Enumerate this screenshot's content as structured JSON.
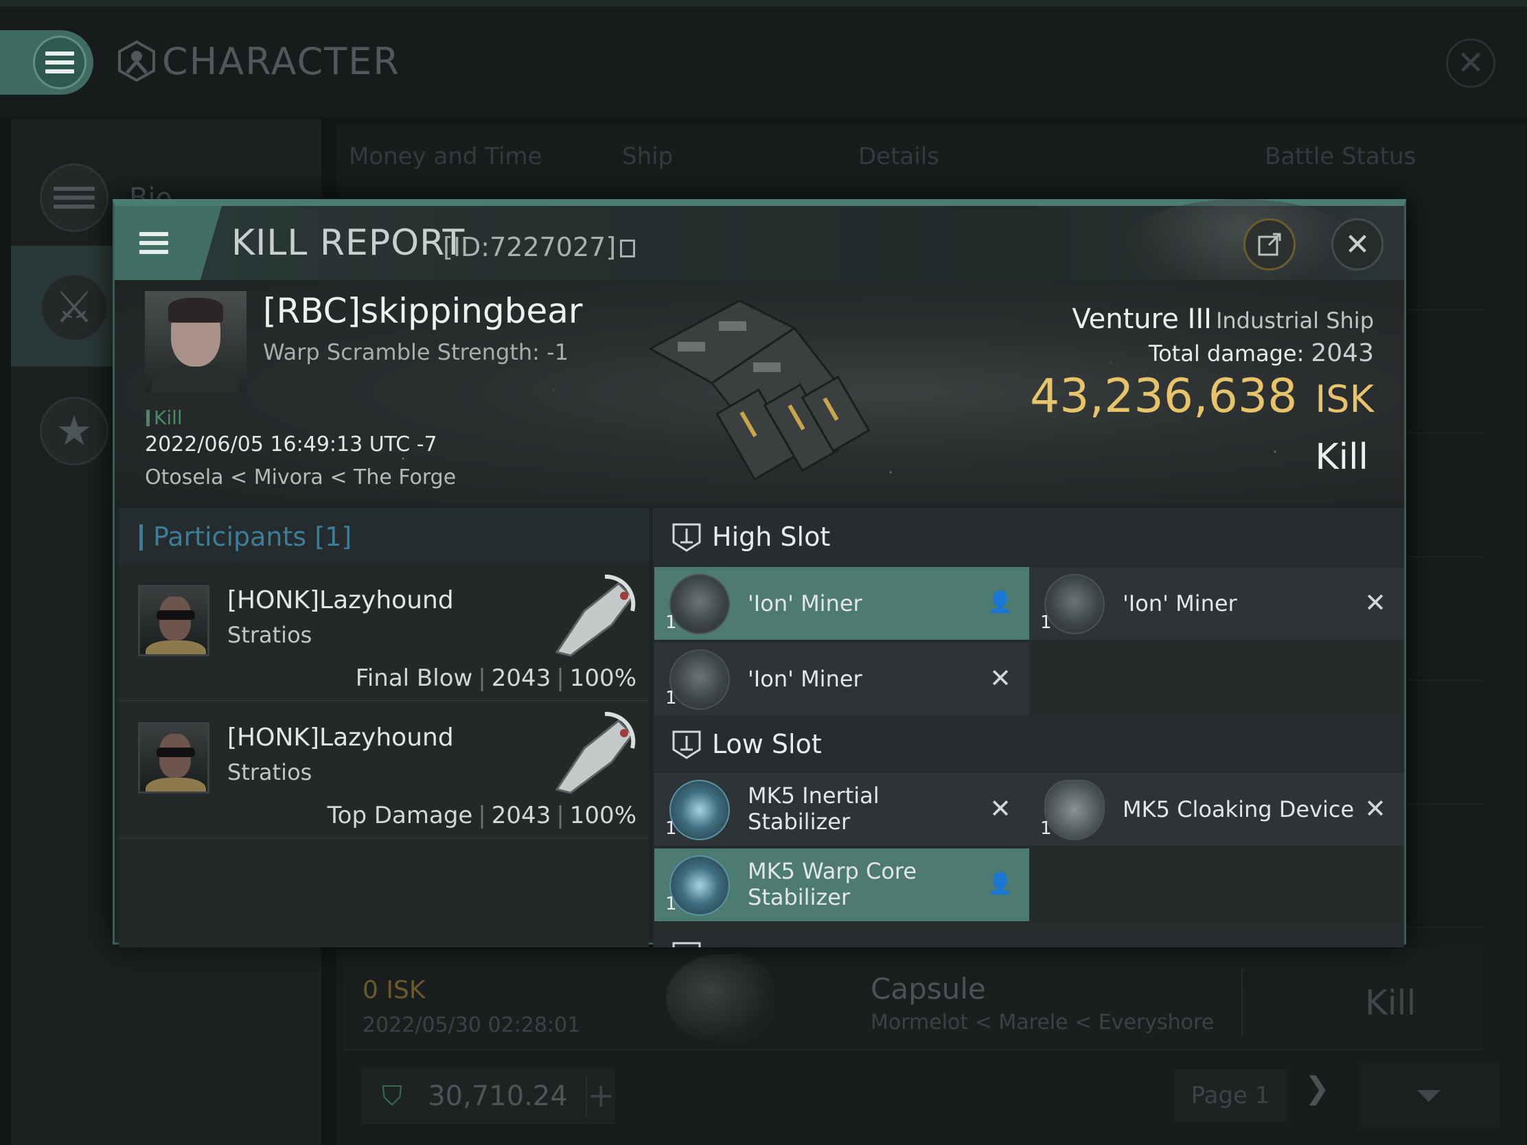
{
  "window": {
    "title": "CHARACTER",
    "icons": {
      "menu": "hamburger-icon",
      "character": "character-emblem-icon",
      "close": "close-icon"
    }
  },
  "sidebar": {
    "items": [
      {
        "label": "Bio",
        "icon": "hamburger-icon"
      },
      {
        "label": "",
        "icon": "crossed-swords-icon"
      },
      {
        "label": "",
        "icon": "star-badge-icon"
      }
    ]
  },
  "tabs": [
    "Money and Time",
    "Ship",
    "Details",
    "Battle Status"
  ],
  "kill_report": {
    "title": "KILL REPORT",
    "id_label": "[ID:7227027]",
    "victim": {
      "name": "[RBC]skippingbear",
      "warp_scramble": "Warp Scramble Strength: -1",
      "type_tag": "Kill",
      "date": "2022/06/05 16:49:13 UTC -7",
      "location": "Otosela < Mivora < The Forge",
      "ship_name": "Venture III",
      "ship_class": "Industrial Ship",
      "total_damage_label": "Total damage:",
      "total_damage_value": "2043",
      "isk_value": "43,236,638",
      "isk_unit": "ISK",
      "result": "Kill"
    },
    "participants": {
      "title": "Participants",
      "count": "[1]",
      "rows": [
        {
          "name": "[HONK]Lazyhound",
          "ship": "Stratios",
          "role": "Final Blow",
          "damage": "2043",
          "percent": "100%"
        },
        {
          "name": "[HONK]Lazyhound",
          "ship": "Stratios",
          "role": "Top Damage",
          "damage": "2043",
          "percent": "100%"
        }
      ]
    },
    "high_slot": {
      "title": "High Slot",
      "modules": [
        {
          "name": "'Ion' Miner",
          "qty": "1",
          "state": "dropped"
        },
        {
          "name": "'Ion' Miner",
          "qty": "1",
          "state": "destroyed"
        },
        {
          "name": "'Ion' Miner",
          "qty": "1",
          "state": "destroyed"
        }
      ]
    },
    "low_slot": {
      "title": "Low Slot",
      "modules": [
        {
          "name_line1": "MK5 Inertial",
          "name_line2": "Stabilizer",
          "qty": "1",
          "state": "destroyed"
        },
        {
          "name": "MK5 Cloaking Device",
          "qty": "1",
          "state": "destroyed"
        },
        {
          "name_line1": "MK5 Warp Core",
          "name_line2": "Stabilizer",
          "qty": "1",
          "state": "dropped"
        }
      ]
    },
    "colors": {
      "accent": "#4d7b72",
      "isk": "#e7c36a",
      "kill_tag": "#4b8a62",
      "participants": "#3c7e9a"
    }
  },
  "background_list": {
    "row": {
      "isk": "0  ISK",
      "date": "2022/05/30  02:28:01",
      "ship": "Capsule",
      "location": "Mormelot < Marele < Everyshore",
      "result": "Kill"
    },
    "wallet": "30,710.24",
    "page": "Page 1"
  }
}
